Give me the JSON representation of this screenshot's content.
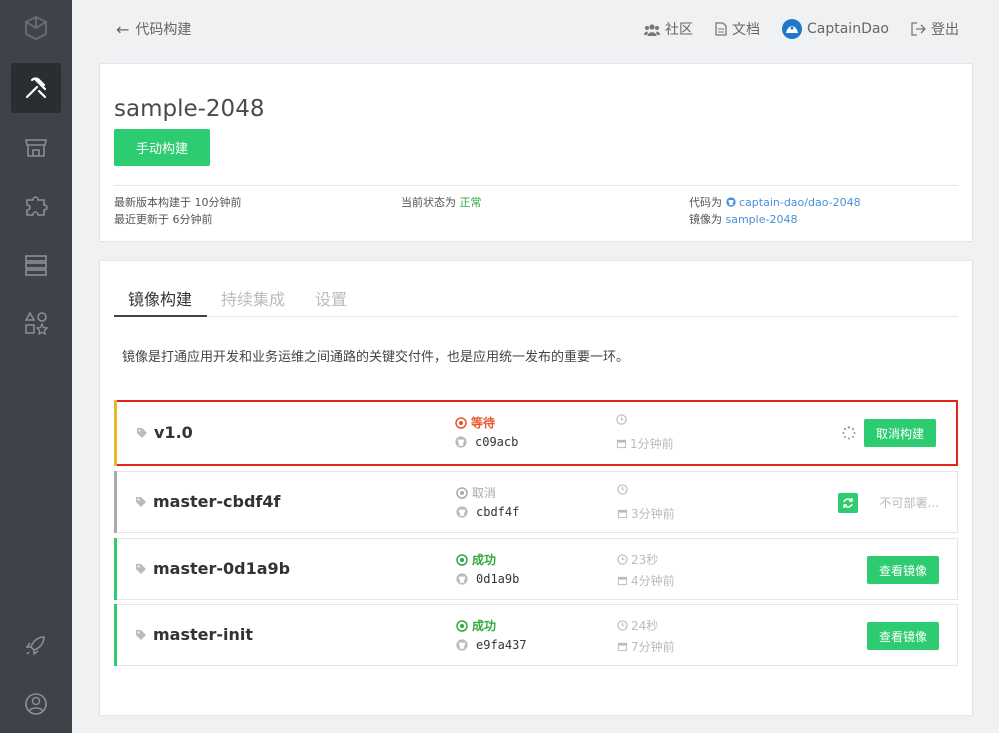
{
  "topbar": {
    "back_label": "代码构建",
    "links": [
      {
        "label": "社区",
        "icon": "users-icon"
      },
      {
        "label": "文档",
        "icon": "document-icon"
      },
      {
        "label": "CaptainDao",
        "icon": "avatar"
      },
      {
        "label": "登出",
        "icon": "logout-icon"
      }
    ]
  },
  "sidebar": {
    "items": [
      {
        "icon": "cube-logo-icon"
      },
      {
        "icon": "tools-icon",
        "active": true
      },
      {
        "icon": "store-icon"
      },
      {
        "icon": "puzzle-icon"
      },
      {
        "icon": "server-icon"
      },
      {
        "icon": "shapes-icon"
      },
      {
        "icon": "rocket-icon"
      },
      {
        "icon": "user-circle-icon"
      }
    ]
  },
  "project": {
    "title": "sample-2048",
    "build_button": "手动构建",
    "latest_build_label": "最新版本构建于 10分钟前",
    "last_update_label": "最近更新于 6分钟前",
    "status_prefix": "当前状态为",
    "status_value": "正常",
    "repo_prefix": "代码为",
    "repo_link": "captain-dao/dao-2048",
    "image_prefix": "镜像为",
    "image_link": "sample-2048"
  },
  "tabs": [
    {
      "label": "镜像构建",
      "active": true
    },
    {
      "label": "持续集成"
    },
    {
      "label": "设置"
    }
  ],
  "description": "镜像是打通应用开发和业务运维之间通路的关键交付件，也是应用统一发布的重要一环。",
  "builds": [
    {
      "name": "v1.0",
      "status": "等待",
      "status_color": "#e8572a",
      "commit": "c09acb",
      "duration": "",
      "ago": "1分钟前",
      "action": "取消构建",
      "bar_color": "#e8b62a",
      "highlighted": true
    },
    {
      "name": "master-cbdf4f",
      "status": "取消",
      "status_color": "#aaaaaa",
      "commit": "cbdf4f",
      "duration": "",
      "ago": "3分钟前",
      "action": "不可部署...",
      "bar_color": "#aaaaaa"
    },
    {
      "name": "master-0d1a9b",
      "status": "成功",
      "status_color": "#2eaa3d",
      "commit": "0d1a9b",
      "duration": "23秒",
      "ago": "4分钟前",
      "action": "查看镜像",
      "bar_color": "#2ecc71"
    },
    {
      "name": "master-init",
      "status": "成功",
      "status_color": "#2eaa3d",
      "commit": "e9fa437",
      "duration": "24秒",
      "ago": "7分钟前",
      "action": "查看镜像",
      "bar_color": "#2ecc71"
    }
  ]
}
